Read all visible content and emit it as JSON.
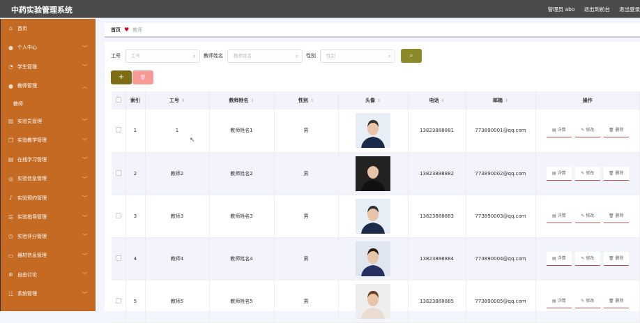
{
  "header": {
    "title": "中药实验管理系统",
    "user": "管理员 abo",
    "to_front": "退出到前台",
    "logout": "退出登录"
  },
  "sidebar": {
    "items": [
      {
        "label": "首页",
        "icon": "home-icon"
      },
      {
        "label": "个人中心",
        "icon": "user-icon"
      },
      {
        "label": "学生管理",
        "icon": "bell-icon"
      },
      {
        "label": "教师管理",
        "icon": "user-icon",
        "expanded": true,
        "children": [
          "教师"
        ]
      },
      {
        "label": "实验员管理",
        "icon": "bar-chart-icon"
      },
      {
        "label": "实验教学管理",
        "icon": "copy-icon"
      },
      {
        "label": "在线学习管理",
        "icon": "clipboard-icon"
      },
      {
        "label": "实验信息管理",
        "icon": "settings-icon"
      },
      {
        "label": "实验预约管理",
        "icon": "mic-icon"
      },
      {
        "label": "实验指导管理",
        "icon": "list-icon"
      },
      {
        "label": "实验评分管理",
        "icon": "clock-icon"
      },
      {
        "label": "器材信息管理",
        "icon": "monitor-icon"
      },
      {
        "label": "自由讨论",
        "icon": "target-icon"
      },
      {
        "label": "系统管理",
        "icon": "sliders-icon"
      }
    ]
  },
  "breadcrumb": {
    "home": "首页",
    "current": "教师"
  },
  "search": {
    "fields": [
      {
        "label": "工号",
        "placeholder": "工号"
      },
      {
        "label": "教师姓名",
        "placeholder": "教师姓名"
      },
      {
        "label": "性别",
        "placeholder": "性别"
      }
    ]
  },
  "toolbar": {
    "add": "+",
    "delete": "🗑"
  },
  "table": {
    "headers": [
      "索引",
      "工号",
      "教师姓名",
      "性别",
      "头像",
      "电话",
      "邮箱",
      "操作"
    ],
    "actions": [
      "详情",
      "修改",
      "删除"
    ],
    "rows": [
      {
        "idx": "1",
        "id": "1",
        "name": "教师姓名1",
        "gender": "男",
        "phone": "13823888881",
        "email": "773890001@qq.com"
      },
      {
        "idx": "2",
        "id": "教师2",
        "name": "教师姓名2",
        "gender": "男",
        "phone": "13823888882",
        "email": "773890002@qq.com"
      },
      {
        "idx": "3",
        "id": "教师3",
        "name": "教师姓名3",
        "gender": "男",
        "phone": "13823888883",
        "email": "773890003@qq.com"
      },
      {
        "idx": "4",
        "id": "教师4",
        "name": "教师姓名4",
        "gender": "男",
        "phone": "13823888884",
        "email": "773890004@qq.com"
      },
      {
        "idx": "5",
        "id": "教师5",
        "name": "教师姓名5",
        "gender": "男",
        "phone": "13823888885",
        "email": "773890005@qq.com"
      }
    ]
  },
  "colors": {
    "header": "#4a4a4a",
    "sidebar": "#c46a22",
    "search_btn": "#8b8a28",
    "add_btn": "#7f6d15",
    "delete_btn": "#f59a95"
  }
}
